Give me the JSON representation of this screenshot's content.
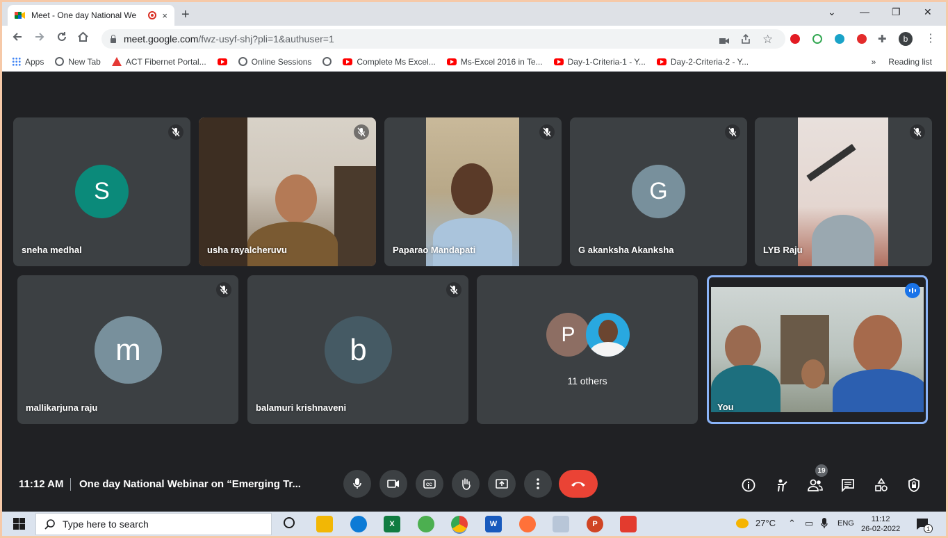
{
  "browser": {
    "tab_title": "Meet - One day National We",
    "tab_close": "×",
    "new_tab": "+",
    "window_controls": [
      "⌄",
      "—",
      "❐",
      "✕"
    ],
    "url_host": "meet.google.com",
    "url_path": "/fwz-usyf-shj?pli=1&authuser=1",
    "profile_initial": "b",
    "bookmarks": [
      "Apps",
      "New Tab",
      "ACT Fibernet Portal...",
      "",
      "Online Sessions",
      "",
      "Complete Ms Excel...",
      "Ms-Excel 2016 in Te...",
      "Day-1-Criteria-1 - Y...",
      "Day-2-Criteria-2 - Y..."
    ],
    "bookmarks_more": "»",
    "reading_list": "Reading list"
  },
  "participants": [
    {
      "name": "sneha medhal",
      "initial": "S",
      "color": "#0b8a7a"
    },
    {
      "name": "usha rayalcheruvu"
    },
    {
      "name": "Paparao Mandapati"
    },
    {
      "name": "G akanksha Akanksha",
      "initial": "G",
      "color": "#78909c"
    },
    {
      "name": "LYB Raju"
    },
    {
      "name": "mallikarjuna raju",
      "initial": "m",
      "color": "#78909c"
    },
    {
      "name": "balamuri krishnaveni",
      "initial": "b",
      "color": "#455a64"
    }
  ],
  "others": {
    "initial": "P",
    "color": "#8d6e63",
    "label": "11 others"
  },
  "self_tile": {
    "name": "You"
  },
  "bottom_bar": {
    "time": "11:12 AM",
    "meeting_title": "One day National Webinar on “Emerging Tr...",
    "participant_count": "19"
  },
  "taskbar": {
    "search_placeholder": "Type here to search",
    "temperature": "27°C",
    "language": "ENG",
    "time": "11:12",
    "date": "26-02-2022",
    "notification_count": "1"
  }
}
